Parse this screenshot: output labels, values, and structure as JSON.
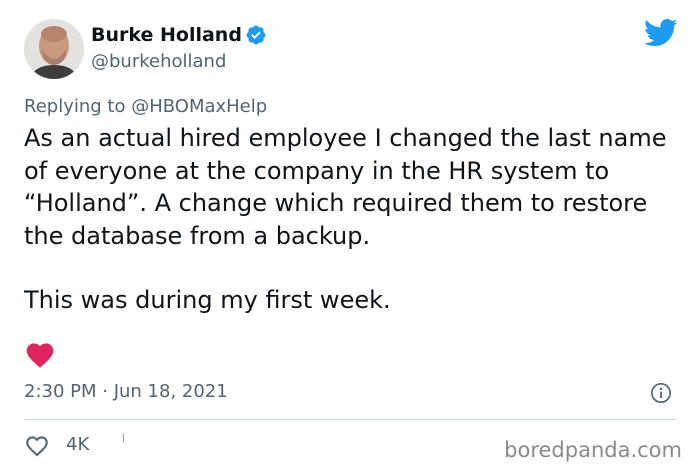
{
  "author": {
    "display_name": "Burke Holland",
    "handle": "@burkeholland",
    "verified": true
  },
  "icons": {
    "verified": "verified-badge-icon",
    "brand": "twitter-bird-icon",
    "reaction": "heart-filled-icon",
    "info": "info-icon",
    "like": "heart-outline-icon"
  },
  "colors": {
    "brand": "#1d9bf0",
    "heart": "#e0245e",
    "secondary_text": "#536471",
    "divider": "#cfd9de"
  },
  "reply": {
    "prefix": "Replying to ",
    "mention": "@HBOMaxHelp"
  },
  "tweet": {
    "paragraphs": [
      "As an actual hired employee I changed the last name of everyone at the company in the HR system to “Holland”. A change which required them to restore the database from a backup.",
      "This was during my first week."
    ],
    "timestamp": "2:30 PM · Jun 18, 2021"
  },
  "actions": {
    "like_count": "4K"
  },
  "watermark": "boredpanda.com"
}
